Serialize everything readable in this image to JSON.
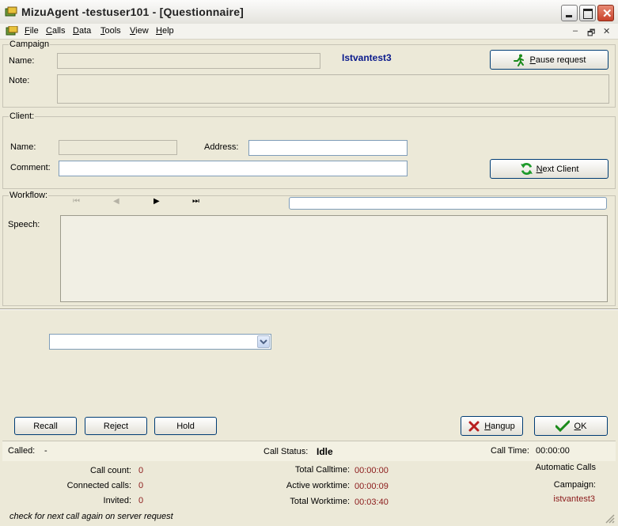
{
  "window": {
    "title": "MizuAgent  -testuser101 - [Questionnaire]"
  },
  "menu": [
    "File",
    "Calls",
    "Data",
    "Tools",
    "View",
    "Help"
  ],
  "campaign": {
    "legend": "Campaign",
    "name_label": "Name:",
    "name_value": "",
    "campaign_title": "Istvantest3",
    "note_label": "Note:",
    "note_value": "",
    "pause_label": "Pause request"
  },
  "client": {
    "legend": "Client:",
    "name_label": "Name:",
    "name_value": "",
    "address_label": "Address:",
    "address_value": "",
    "comment_label": "Comment:",
    "comment_value": "",
    "next_client_label": "Next Client"
  },
  "workflow": {
    "legend": "Workflow:",
    "speech_label": "Speech:",
    "speech_text": "",
    "nav": [
      "⏮",
      "◀",
      "▶",
      "⏭"
    ]
  },
  "dropdown": {
    "selected": ""
  },
  "buttons": {
    "recall": "Recall",
    "reject": "Reject",
    "hold": "Hold",
    "hangup": "Hangup",
    "ok": "OK"
  },
  "status": {
    "called_label": "Called:",
    "called_value": "-",
    "call_status_label": "Call Status:",
    "call_status_value": "Idle",
    "call_time_label": "Call Time:",
    "call_time_value": "00:00:00"
  },
  "stats": {
    "call_count_label": "Call count:",
    "call_count_value": "0",
    "connected_label": "Connected calls:",
    "connected_value": "0",
    "invited_label": "Invited:",
    "invited_value": "0",
    "total_calltime_label": "Total Calltime:",
    "total_calltime_value": "00:00:00",
    "active_worktime_label": "Active worktime:",
    "active_worktime_value": "00:00:09",
    "total_worktime_label": "Total Worktime:",
    "total_worktime_value": "00:03:40",
    "automatic_calls_label": "Automatic Calls",
    "campaign_label": "Campaign:",
    "campaign_value": "istvantest3"
  },
  "footer_message": "check for next call again on server request",
  "colors": {
    "accent_blue": "#0a1a8c",
    "value_red": "#8b1a1a",
    "speech_bg": "#f1efe4"
  }
}
